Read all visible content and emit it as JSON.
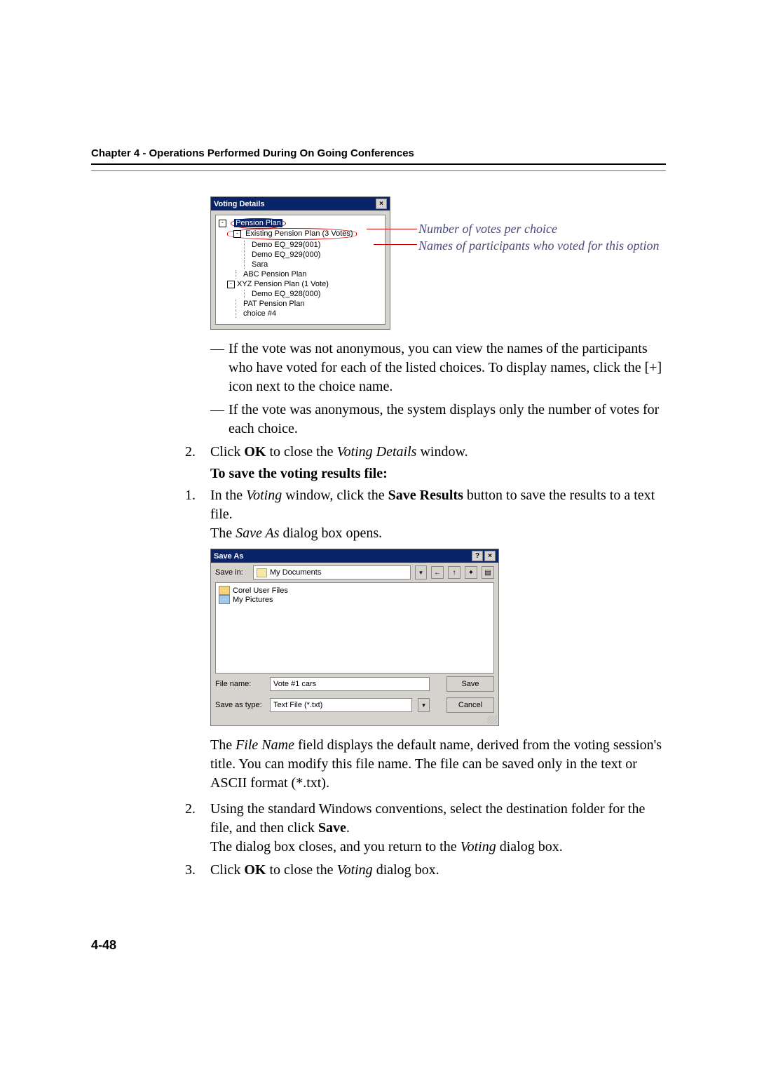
{
  "header": {
    "title": "Chapter 4 - Operations Performed During On Going Conferences"
  },
  "page_number": "4-48",
  "voting_details": {
    "title": "Voting Details",
    "root": "Pension Plan",
    "existing": "Existing Pension Plan (3 Votes)",
    "p1": "Demo EQ_929(001)",
    "p2": "Demo EQ_929(000)",
    "p3": "Sara",
    "abc": "ABC Pension Plan",
    "xyz": "XYZ Pension Plan (1 Vote)",
    "xyz_p1": "Demo EQ_928(000)",
    "pat": "PAT Pension Plan",
    "c4": "choice #4"
  },
  "annot": {
    "line1": "Number of votes per choice",
    "line2": "Names of participants who voted for this option"
  },
  "body": {
    "bullet1": "If the vote was not anonymous, you can view the names of the participants who have voted for each of the listed choices. To display names, click the [+] icon next to the choice name.",
    "bullet2": "If the vote was anonymous, the system displays only the number of votes for each choice.",
    "step2_pre": "Click ",
    "step2_strong": "OK",
    "step2_post_a": " to close the ",
    "step2_em": "Voting Details",
    "step2_post_b": " window.",
    "section": "To save the voting results file:",
    "s1_pre": "In the ",
    "s1_em1": "Voting",
    "s1_mid": " window, click the ",
    "s1_strong": "Save Results",
    "s1_post": " button to save the results to a text file.",
    "s1_line2_pre": "The ",
    "s1_line2_em": "Save As",
    "s1_line2_post": " dialog box opens.",
    "p_after_saveas_pre": "The ",
    "p_after_saveas_em": "File Name",
    "p_after_saveas_post": " field displays the default name, derived from the voting session's title. You can modify this file name. The file can be saved only in the text or ASCII format (*.txt).",
    "s2_a": "Using the standard Windows conventions, select the destination folder for the file, and then click ",
    "s2_strong": "Save",
    "s2_b": ".",
    "s2_line2_a": "The dialog box closes, and you return to the ",
    "s2_line2_em": "Voting",
    "s2_line2_b": " dialog box.",
    "s3_a": "Click ",
    "s3_strong": "OK",
    "s3_b": " to close the ",
    "s3_em": "Voting",
    "s3_c": " dialog box."
  },
  "saveas": {
    "title": "Save As",
    "save_in_label": "Save in:",
    "save_in_value": "My Documents",
    "folder1": "Corel User Files",
    "folder2": "My Pictures",
    "file_name_label": "File name:",
    "file_name_value": "Vote #1 cars",
    "type_label": "Save as type:",
    "type_value": "Text File (*.txt)",
    "save_btn": "Save",
    "cancel_btn": "Cancel",
    "nav_back": "←",
    "nav_up": "↑",
    "nav_new": "✦",
    "nav_view": "▤",
    "help_btn": "?",
    "close_btn": "×",
    "dd": "▾"
  }
}
